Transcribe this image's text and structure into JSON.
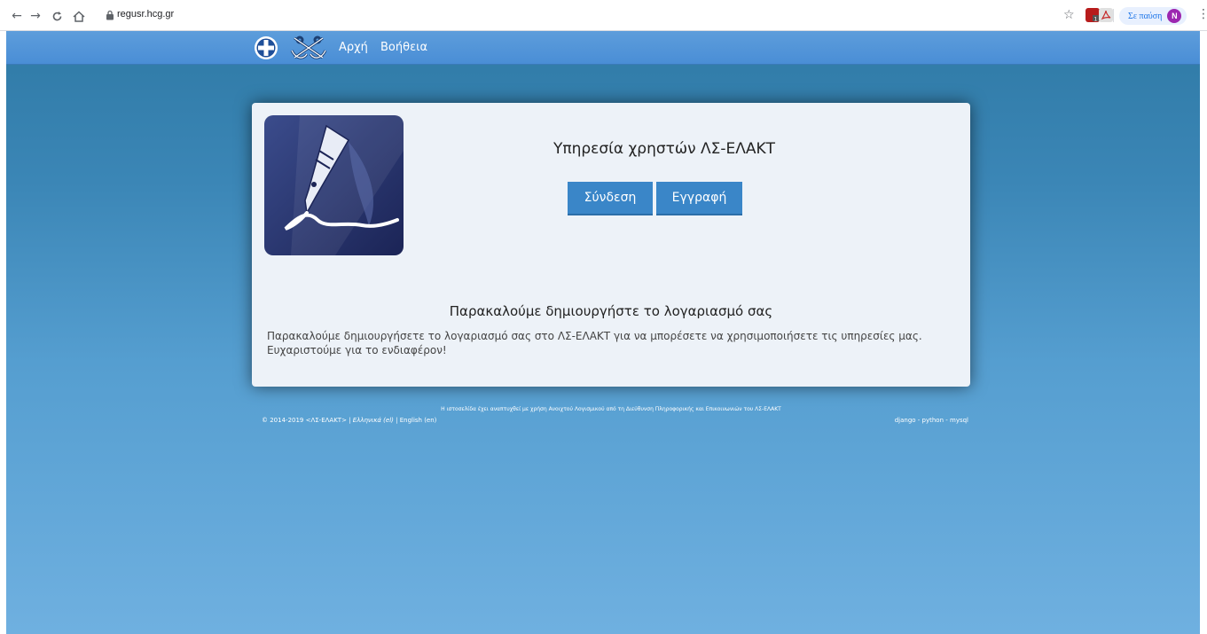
{
  "browser": {
    "url": "regusr.hcg.gr",
    "profile_status": "Σε παύση",
    "profile_initial": "N",
    "icons": {
      "back": "arrow-left-icon",
      "forward": "arrow-right-icon",
      "reload": "reload-icon",
      "home": "home-icon",
      "lock": "lock-icon",
      "bookmark": "star-icon",
      "menu": "kebab-menu-icon"
    }
  },
  "nav": {
    "items": [
      {
        "label": "Αρχή"
      },
      {
        "label": "Βοήθεια"
      }
    ]
  },
  "card": {
    "title": "Υπηρεσία χρηστών ΛΣ-ΕΛΑΚΤ",
    "login_label": "Σύνδεση",
    "register_label": "Εγγραφή",
    "subtitle": "Παρακαλούμε δημιουργήστε το λογαριασμό σας",
    "paragraph": "Παρακαλούμε δημιουργήσετε το λογαριασμό σας στο ΛΣ-ΕΛΑΚΤ για να μπορέσετε να χρησιμοποιήσετε τις υπηρεσίες μας. Ευχαριστούμε για το ενδιαφέρον!"
  },
  "footer": {
    "note": "Η ιστοσελίδα έχει αναπτυχθεί με χρήση Ανοιχτού Λογισμικού από τη Διεύθυνση Πληροφορικής και Επικοινωνιών του ΛΣ-ΕΛΑΚΤ",
    "copyright": "© 2014-2019 <ΛΣ-ΕΛΑΚΤ> |",
    "lang_el": "Ελληνικά (el)",
    "lang_sep": "|",
    "lang_en": "English (en)",
    "tech": "django - python - mysql"
  },
  "colors": {
    "topbar": "#4a8ed6",
    "button": "#3a86c8",
    "card_bg": "#edf2f8",
    "page_bg_top": "#2f7aa6",
    "page_bg_bottom": "#6fb0e0"
  }
}
